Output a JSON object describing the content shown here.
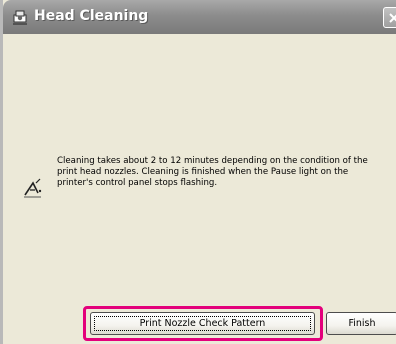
{
  "window": {
    "title": "Head Cleaning"
  },
  "icons": {
    "title": "printer-cleaning-icon",
    "info": "print-head-info-icon",
    "close": "close-icon"
  },
  "message": "Cleaning takes about 2 to 12 minutes depending on the condition of the print head nozzles. Cleaning is finished when the Pause light on the printer's control panel stops flashing.",
  "buttons": {
    "print_nozzle": "Print Nozzle Check Pattern",
    "finish": "Finish"
  },
  "colors": {
    "highlight": "#e3007b",
    "titlebar": "#8c8c8c",
    "dialog_bg": "#ece9d8"
  }
}
